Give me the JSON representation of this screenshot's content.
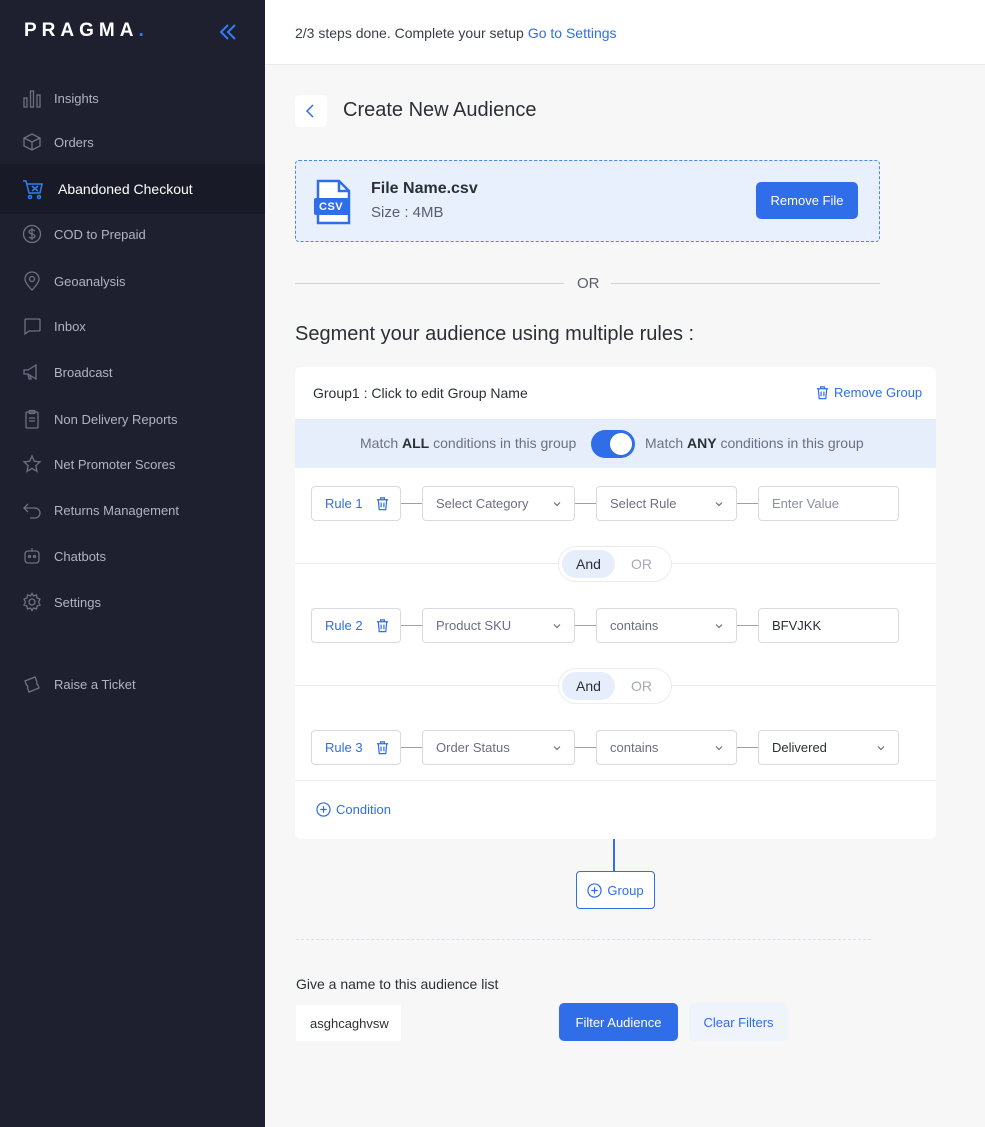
{
  "brand": {
    "name": "PRAGMA",
    "dot": "."
  },
  "sidebar": {
    "items": [
      {
        "label": "Insights",
        "icon": "bar-chart-icon"
      },
      {
        "label": "Orders",
        "icon": "box-icon"
      },
      {
        "label": "Abandoned Checkout",
        "icon": "cart-icon",
        "active": true
      },
      {
        "label": "COD to Prepaid",
        "icon": "dollar-icon"
      },
      {
        "label": "Geoanalysis",
        "icon": "map-pin-icon"
      },
      {
        "label": "Inbox",
        "icon": "chat-icon"
      },
      {
        "label": "Broadcast",
        "icon": "megaphone-icon"
      },
      {
        "label": "Non Delivery Reports",
        "icon": "clipboard-icon"
      },
      {
        "label": "Net Promoter Scores",
        "icon": "star-icon"
      },
      {
        "label": "Returns Management",
        "icon": "return-icon"
      },
      {
        "label": "Chatbots",
        "icon": "bot-icon"
      },
      {
        "label": "Settings",
        "icon": "gear-icon"
      },
      {
        "label": "Raise a Ticket",
        "icon": "ticket-icon"
      }
    ]
  },
  "topbar": {
    "message": "2/3 steps done. Complete your setup",
    "link": "Go to Settings"
  },
  "page": {
    "title": "Create New Audience"
  },
  "file": {
    "name": "File Name.csv",
    "size": "Size : 4MB",
    "badge": "CSV",
    "remove_label": "Remove File"
  },
  "divider": {
    "or": "OR"
  },
  "segment": {
    "title": "Segment your audience using multiple rules :"
  },
  "group": {
    "name": "Group1 : Click to edit Group Name",
    "remove_label": "Remove Group",
    "match_all_prefix": "Match ",
    "match_all_bold": "ALL",
    "match_all_suffix": " conditions in this group",
    "match_any_prefix": "Match ",
    "match_any_bold": "ANY",
    "match_any_suffix": " conditions in this group",
    "rules": [
      {
        "label": "Rule 1",
        "category": "Select Category",
        "rule": "Select Rule",
        "value": "Enter Value"
      },
      {
        "label": "Rule 2",
        "category": "Product SKU",
        "rule": "contains",
        "value": "BFVJKK"
      },
      {
        "label": "Rule 3",
        "category": "Order Status",
        "rule": "contains",
        "value": "Delivered"
      }
    ],
    "and_label": "And",
    "or_label": "OR",
    "add_condition": "Condition"
  },
  "add_group": "Group",
  "audience": {
    "name_label": "Give a name to this audience list",
    "name_value": "asghcaghvsw",
    "filter_label": "Filter Audience",
    "clear_label": "Clear Filters"
  },
  "colors": {
    "accent": "#2f6ee8",
    "sidebar_bg": "#1e2030"
  }
}
